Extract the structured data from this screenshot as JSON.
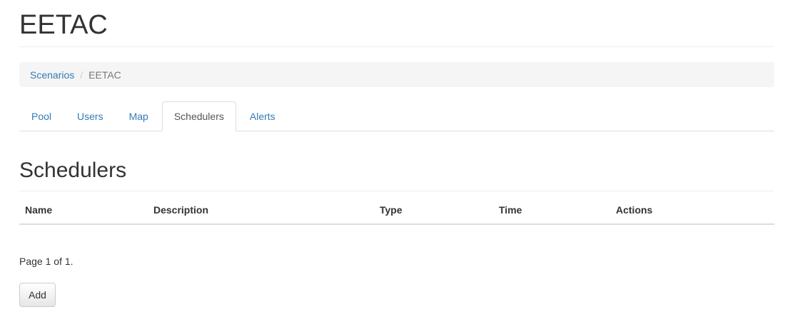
{
  "header": {
    "title": "EETAC"
  },
  "breadcrumb": {
    "items": [
      {
        "label": "Scenarios",
        "link": true
      },
      {
        "label": "EETAC",
        "link": false
      }
    ],
    "separator": "/"
  },
  "tabs": [
    {
      "label": "Pool",
      "active": false
    },
    {
      "label": "Users",
      "active": false
    },
    {
      "label": "Map",
      "active": false
    },
    {
      "label": "Schedulers",
      "active": true
    },
    {
      "label": "Alerts",
      "active": false
    }
  ],
  "section": {
    "title": "Schedulers"
  },
  "table": {
    "columns": [
      "Name",
      "Description",
      "Type",
      "Time",
      "Actions"
    ],
    "rows": []
  },
  "pager": {
    "text": "Page 1 of 1."
  },
  "actions": {
    "add_label": "Add"
  },
  "colors": {
    "link": "#337ab7",
    "text": "#333333",
    "muted": "#777777",
    "breadcrumb_bg": "#f5f5f5"
  }
}
